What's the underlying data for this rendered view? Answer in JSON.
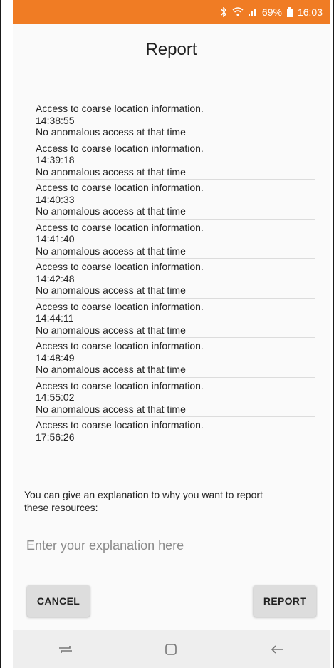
{
  "status_bar": {
    "battery_text": "69%",
    "time": "16:03",
    "icons": [
      "bluetooth-icon",
      "wifi-icon",
      "signal-icon",
      "battery-icon"
    ]
  },
  "title": "Report",
  "entries": [
    {
      "description": "Access to coarse location information.",
      "time": "14:38:55",
      "status": "No anomalous access at that time"
    },
    {
      "description": "Access to coarse location information.",
      "time": "14:39:18",
      "status": "No anomalous access at that time"
    },
    {
      "description": "Access to coarse location information.",
      "time": "14:40:33",
      "status": "No anomalous access at that time"
    },
    {
      "description": "Access to coarse location information.",
      "time": "14:41:40",
      "status": "No anomalous access at that time"
    },
    {
      "description": "Access to coarse location information.",
      "time": "14:42:48",
      "status": "No anomalous access at that time"
    },
    {
      "description": "Access to coarse location information.",
      "time": "14:44:11",
      "status": "No anomalous access at that time"
    },
    {
      "description": "Access to coarse location information.",
      "time": "14:48:49",
      "status": "No anomalous access at that time"
    },
    {
      "description": "Access to coarse location information.",
      "time": "14:55:02",
      "status": "No anomalous access at that time"
    },
    {
      "description": "Access to coarse location information.",
      "time": "17:56:26",
      "status": ""
    }
  ],
  "explanation_prompt": "You can give an explanation to why you want to report these resources:",
  "explanation_input": {
    "value": "",
    "placeholder": "Enter your explanation here"
  },
  "buttons": {
    "cancel": "CANCEL",
    "report": "REPORT"
  },
  "nav_bar": {
    "icons": [
      "recents-icon",
      "home-icon",
      "back-icon"
    ]
  },
  "colors": {
    "status_bar": "#f07c24",
    "background": "#fafafa",
    "button": "#dddddd",
    "nav_bar": "#eeeeee"
  }
}
